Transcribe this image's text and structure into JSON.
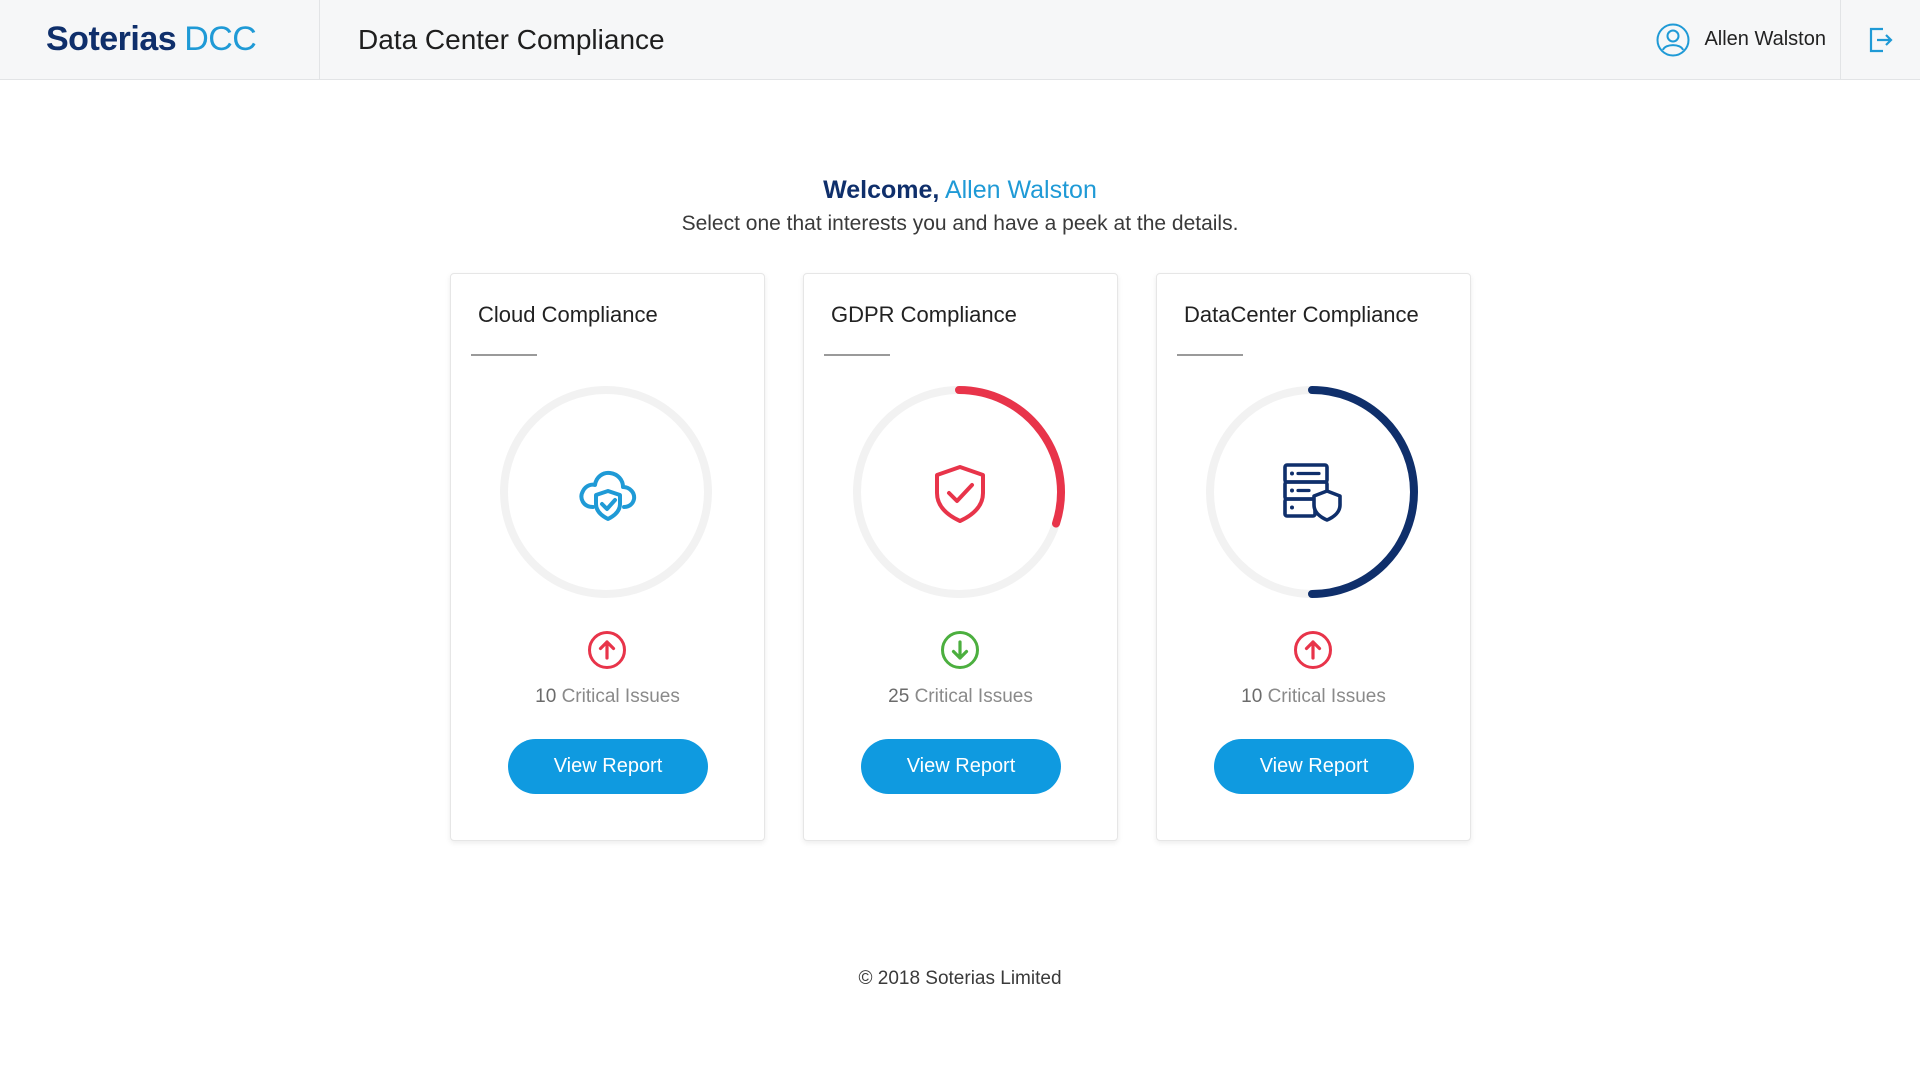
{
  "header": {
    "brand_main": "Soterias",
    "brand_sub": "DCC",
    "title": "Data Center Compliance",
    "user_name": "Allen Walston"
  },
  "welcome": {
    "greeting": "Welcome,",
    "name": "Allen Walston",
    "subtitle": "Select one that interests you and have a peek at the details."
  },
  "cards": [
    {
      "title": "Cloud Compliance",
      "icon": "cloud-shield-icon",
      "progress": 0,
      "ring_color": "#e8344a",
      "trend": "up",
      "trend_color": "#e8344a",
      "issues_count": "10",
      "issues_label": "Critical Issues",
      "button_label": "View Report"
    },
    {
      "title": "GDPR Compliance",
      "icon": "shield-check-icon",
      "progress": 0.3,
      "ring_color": "#e8344a",
      "trend": "down",
      "trend_color": "#4caf3f",
      "issues_count": "25",
      "issues_label": "Critical Issues",
      "button_label": "View Report"
    },
    {
      "title": "DataCenter Compliance",
      "icon": "server-shield-icon",
      "progress": 0.5,
      "ring_color": "#0f2f6b",
      "trend": "up",
      "trend_color": "#e8344a",
      "issues_count": "10",
      "issues_label": "Critical Issues",
      "button_label": "View Report"
    }
  ],
  "footer": {
    "copyright": "© 2018 Soterias Limited"
  },
  "colors": {
    "brand_navy": "#0f2f6b",
    "brand_blue": "#1f9ad6",
    "button_blue": "#0f9ae0",
    "alert_red": "#e8344a",
    "ok_green": "#4caf3f"
  }
}
